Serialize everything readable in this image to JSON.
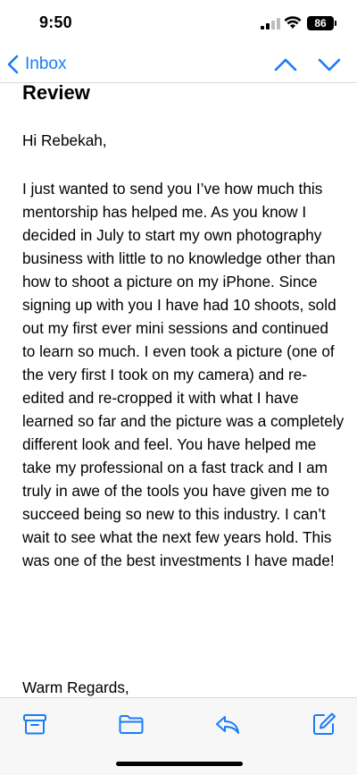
{
  "status_bar": {
    "time": "9:50",
    "battery": "86",
    "signal_icon": "cellular-signal-icon",
    "wifi_icon": "wifi-icon"
  },
  "nav": {
    "back_label": "Inbox",
    "back_icon": "chevron-left-icon",
    "prev_icon": "chevron-up-icon",
    "next_icon": "chevron-down-icon",
    "accent_color": "#1a7cf7"
  },
  "email": {
    "subject": "Review",
    "greeting": "Hi Rebekah,",
    "body": "I just wanted to send you I’ve how much this mentorship has helped me. As you know I decided in July to start my own photography business with little to no knowledge other than how to shoot a picture on my iPhone. Since signing up with you I have had 10 shoots, sold out my first ever mini sessions and continued to learn so much. I even took a picture (one of the very first I took on my camera) and re-edited and re-cropped it with what I have learned so far and the picture was a completely different look and feel. You have helped me take my professional on a fast track and I am truly in awe of the tools you have given me to succeed being so new to this industry. I can’t wait to see what the next few years hold. This was one of the best investments I have made!",
    "signoff": "Warm Regards,"
  },
  "toolbar": {
    "icons": [
      "archive-icon",
      "folder-icon",
      "reply-icon",
      "compose-icon"
    ]
  }
}
